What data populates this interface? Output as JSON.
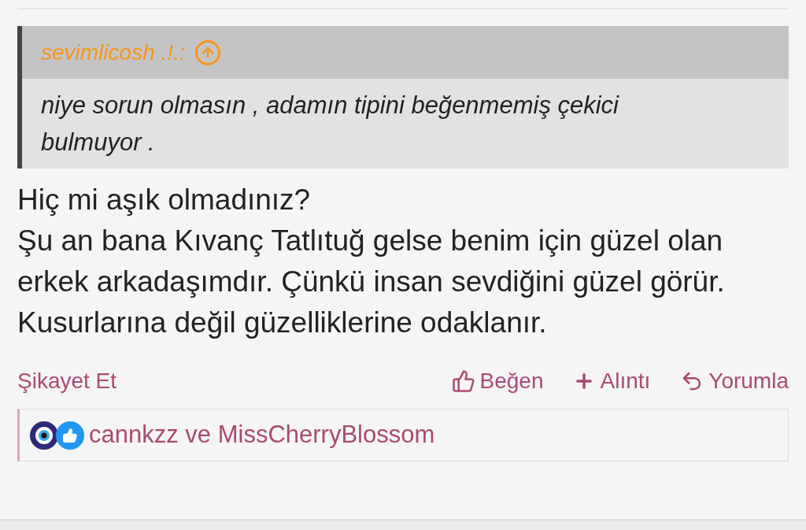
{
  "quote": {
    "author": "sevimlicosh .!.:",
    "text": "niye sorun olmasın , adamın tipini beğenmemiş çekici bulmuyor ."
  },
  "post": {
    "lines": [
      "Hiç mi aşık olmadınız?",
      "Şu an bana Kıvanç Tatlıtuğ gelse benim için güzel olan",
      "erkek arkadaşımdır. Çünkü insan sevdiğini güzel görür.",
      "Kusurlarına değil güzelliklerine odaklanır."
    ]
  },
  "actions": {
    "report": "Şikayet Et",
    "items": [
      {
        "kind": "like",
        "label": "Beğen"
      },
      {
        "kind": "quote",
        "label": "Alıntı"
      },
      {
        "kind": "reply",
        "label": "Yorumla"
      }
    ]
  },
  "reactions": {
    "users": "cannkzz ve MissCherryBlossom"
  }
}
